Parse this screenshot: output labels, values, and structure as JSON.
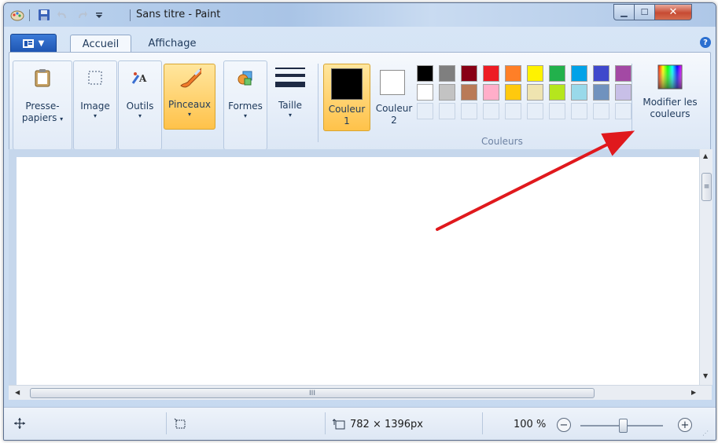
{
  "window": {
    "title": "Sans titre - Paint"
  },
  "tabs": [
    {
      "label": "Accueil"
    },
    {
      "label": "Affichage"
    }
  ],
  "ribbon": {
    "presse_papiers": {
      "line1": "Presse-",
      "line2": "papiers"
    },
    "image": "Image",
    "outils": "Outils",
    "pinceaux": "Pinceaux",
    "formes": "Formes",
    "taille": "Taille",
    "couleur1": {
      "line1": "Couleur",
      "line2": "1"
    },
    "couleur2": {
      "line1": "Couleur",
      "line2": "2"
    },
    "couleurs_group_label": "Couleurs",
    "modifier": {
      "line1": "Modifier les",
      "line2": "couleurs"
    }
  },
  "colors": {
    "couleur1": "#000000",
    "couleur2": "#ffffff",
    "palette_row1": [
      "#000000",
      "#7f7f7f",
      "#880015",
      "#ed1c24",
      "#ff7f27",
      "#fff200",
      "#22b14c",
      "#00a2e8",
      "#3f48cc",
      "#a349a4"
    ],
    "palette_row2": [
      "#ffffff",
      "#c3c3c3",
      "#b97a57",
      "#ffaec9",
      "#ffc90e",
      "#efe4b0",
      "#b5e61d",
      "#99d9ea",
      "#7092be",
      "#c8bfe7"
    ],
    "annotation_arrow": "#e0191d"
  },
  "scrollbars": {
    "grip": "III"
  },
  "status": {
    "image_size": "782 × 1396px",
    "zoom": "100 %"
  }
}
